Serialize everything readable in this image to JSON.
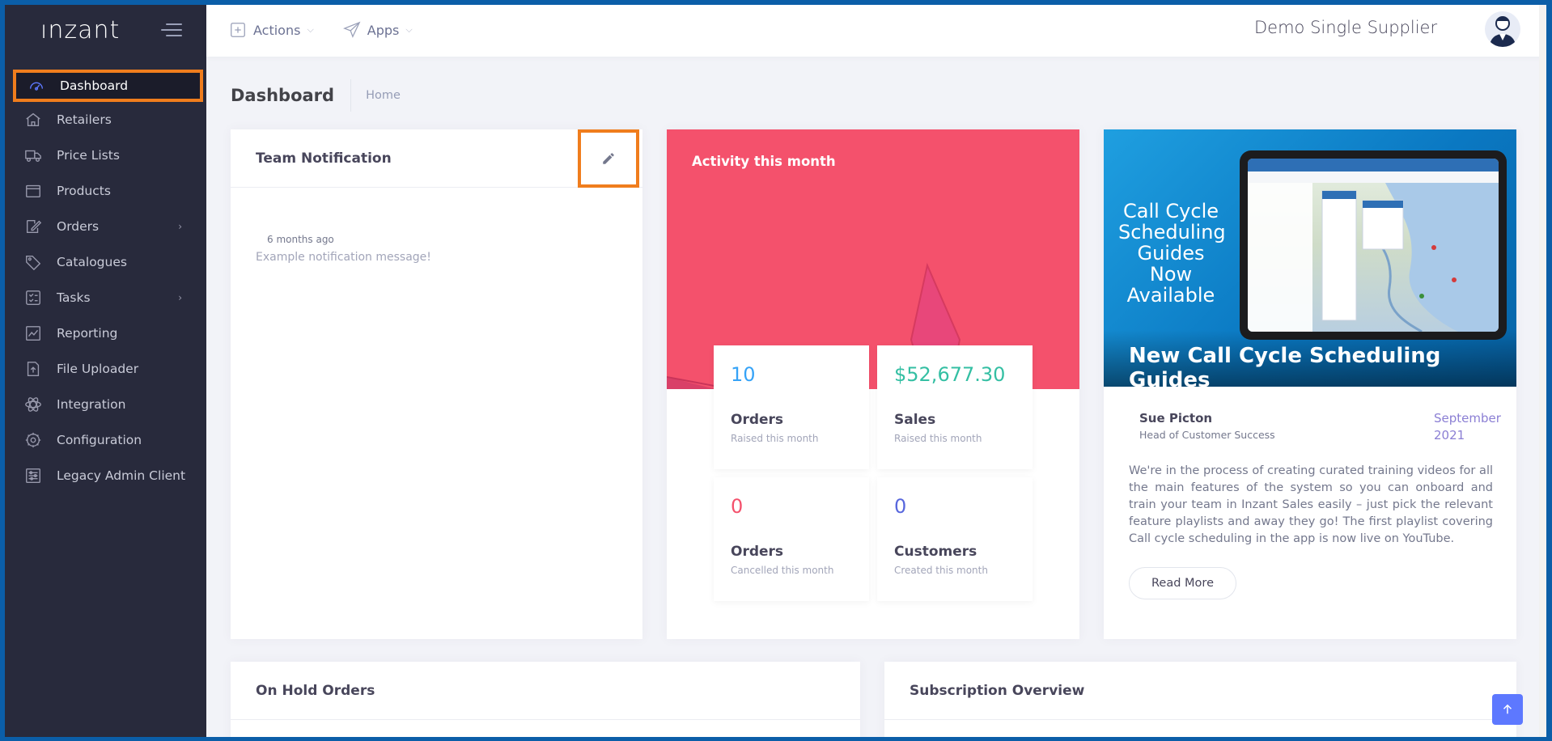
{
  "app": {
    "brand": "ınzant"
  },
  "sidebar": {
    "items": [
      {
        "label": "Dashboard",
        "icon": "dashboard-icon",
        "active": true
      },
      {
        "label": "Retailers",
        "icon": "home-icon"
      },
      {
        "label": "Price Lists",
        "icon": "truck-icon"
      },
      {
        "label": "Products",
        "icon": "box-icon"
      },
      {
        "label": "Orders",
        "icon": "edit-icon",
        "has_children": true
      },
      {
        "label": "Catalogues",
        "icon": "tag-icon"
      },
      {
        "label": "Tasks",
        "icon": "checklist-icon",
        "has_children": true
      },
      {
        "label": "Reporting",
        "icon": "chart-icon"
      },
      {
        "label": "File Uploader",
        "icon": "upload-icon"
      },
      {
        "label": "Integration",
        "icon": "atom-icon"
      },
      {
        "label": "Configuration",
        "icon": "gear-icon"
      },
      {
        "label": "Legacy Admin Client",
        "icon": "sliders-icon"
      }
    ]
  },
  "topbar": {
    "actions_label": "Actions",
    "apps_label": "Apps",
    "user_name": "Demo Single Supplier"
  },
  "subheader": {
    "title": "Dashboard",
    "breadcrumb": "Home"
  },
  "team_notification": {
    "title": "Team Notification",
    "time": "6 months ago",
    "message": "Example notification message!"
  },
  "activity": {
    "title": "Activity this month",
    "accent_color": "#f4516c",
    "stats": [
      {
        "value": "10",
        "label": "Orders",
        "sub": "Raised this month",
        "color": "#36a3f7"
      },
      {
        "value": "$52,677.30",
        "label": "Sales",
        "sub": "Raised this month",
        "color": "#34bfa3"
      },
      {
        "value": "0",
        "label": "Orders",
        "sub": "Cancelled this month",
        "color": "#f4516c"
      },
      {
        "value": "0",
        "label": "Customers",
        "sub": "Created this month",
        "color": "#5867dd"
      }
    ]
  },
  "news": {
    "hero_text": "Call Cycle Scheduling Guides Now Available",
    "title": "New Call Cycle Scheduling Guides",
    "author": "Sue Picton",
    "author_role": "Head of Customer Success",
    "date": "September 2021",
    "body": "We're in the process of creating curated training videos for all the main features of the system so you can onboard and train your team in Inzant Sales easily – just pick the relevant feature playlists and away they go! The first playlist covering Call cycle scheduling in the app is now live on YouTube.",
    "read_more": "Read More"
  },
  "on_hold_orders": {
    "title": "On Hold Orders"
  },
  "subscription_overview": {
    "title": "Subscription Overview"
  }
}
